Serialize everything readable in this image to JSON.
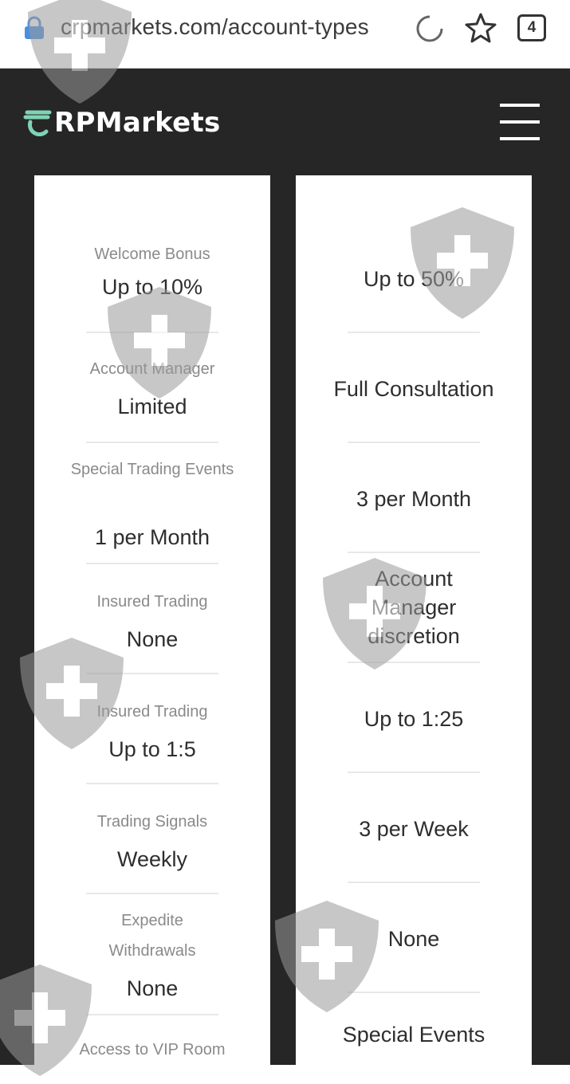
{
  "browser": {
    "url": "crpmarkets.com/account-types",
    "tab_count": "4"
  },
  "header": {
    "logo_text": "RPMarkets",
    "logo_color": "#7fd3b4"
  },
  "left_card": {
    "rows": [
      {
        "label": "Welcome Bonus",
        "value": "Up to 10%"
      },
      {
        "label": "Account Manager",
        "value": "Limited"
      },
      {
        "label": "Special Trading Events",
        "value": "1 per Month"
      },
      {
        "label": "Insured Trading",
        "value": "None"
      },
      {
        "label": "Insured Trading",
        "value": "Up to 1:5"
      },
      {
        "label": "Trading Signals",
        "value": "Weekly"
      },
      {
        "label": "Expedite Withdrawals",
        "value": "None"
      },
      {
        "label": "Access to VIP Room",
        "value": ""
      }
    ]
  },
  "right_card": {
    "rows": [
      {
        "value": "Up to 50%"
      },
      {
        "value": "Full Consultation"
      },
      {
        "value": "3 per Month"
      },
      {
        "value": "Account Manager discretion"
      },
      {
        "value": "Up to 1:25"
      },
      {
        "value": "3 per Week"
      },
      {
        "value": "None"
      },
      {
        "value": "Special Events"
      }
    ]
  }
}
